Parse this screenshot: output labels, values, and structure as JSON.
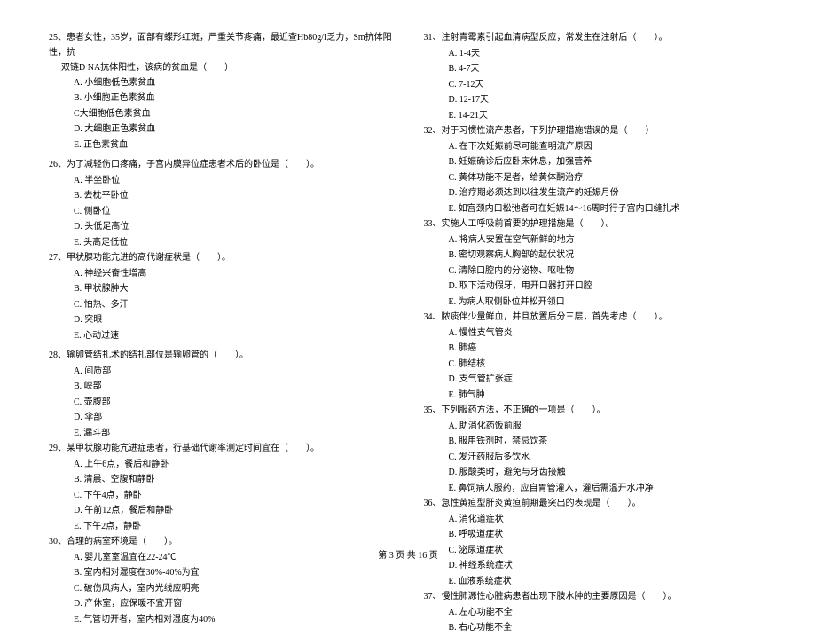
{
  "footer": "第 3 页 共 16 页",
  "left": {
    "q25": {
      "line1": "25、患者女性，35岁，面部有蝶形红斑，严重关节疼痛，最近查Hb80g/I乏力，Sm抗体阳性，抗",
      "line2": "双链D NA抗体阳性，该病的贫血是（　　）",
      "optA": "A. 小细胞低色素贫血",
      "optB": "B. 小细胞正色素贫血",
      "optC": "C大细胞低色素贫血",
      "optD": "D. 大细胞正色素贫血",
      "optE": "E. 正色素贫血"
    },
    "q26": {
      "stem": "26、为了减轻伤口疼痛，子宫内膜异位症患者术后的卧位是（　　）。",
      "optA": "A. 半坐卧位",
      "optB": "B. 去枕平卧位",
      "optC": "C. 侧卧位",
      "optD": "D. 头低足高位",
      "optE": "E. 头高足低位"
    },
    "q27": {
      "stem": "27、甲状腺功能亢进的高代谢症状是（　　）。",
      "optA": "A. 神经兴奋性增高",
      "optB": "B. 甲状腺肿大",
      "optC": "C. 怕热、多汗",
      "optD": "D. 突眼",
      "optE": "E. 心动过速"
    },
    "q28": {
      "stem": "28、输卵管结扎术的结扎部位是输卵管的（　　）。",
      "optA": "A. 间质部",
      "optB": "B. 峡部",
      "optC": "C. 壶腹部",
      "optD": "D. 伞部",
      "optE": "E. 漏斗部"
    },
    "q29": {
      "stem": "29、某甲状腺功能亢进症患者，行基础代谢率测定时间宜在（　　）。",
      "optA": "A. 上午6点，餐后和静卧",
      "optB": "B. 清晨、空腹和静卧",
      "optC": "C. 下午4点，静卧",
      "optD": "D. 午前12点，餐后和静卧",
      "optE": "E. 下午2点，静卧"
    },
    "q30": {
      "stem": "30、合理的病室环境是（　　）。",
      "optA": "A. 婴儿室室温宜在22-24℃",
      "optB": "B. 室内相对湿度在30%-40%为宜",
      "optC": "C. 破伤风病人，室内光线应明亮",
      "optD": "D. 产休室，应保暖不宜开窗",
      "optE": "E. 气管切开者，室内相对湿度为40%"
    }
  },
  "right": {
    "q31": {
      "stem": "31、注射青霉素引起血清病型反应，常发生在注射后（　　）。",
      "optA": "A. 1-4天",
      "optB": "B. 4-7天",
      "optC": "C. 7-12天",
      "optD": "D. 12-17天",
      "optE": "E. 14-21天"
    },
    "q32": {
      "stem": "32、对于习惯性流产患者，下列护理措施错误的是（　　）",
      "optA": "A. 在下次妊娠前尽可能查明流产原因",
      "optB": "B. 妊娠确诊后应卧床休息，加强营养",
      "optC": "C. 黄体功能不足者，给黄体酮治疗",
      "optD": "D. 治疗期必须达到以往发生流产的妊娠月份",
      "optE": "E. 如宫颈内口松弛者可在妊娠14～16周时行子宫内口缝扎术"
    },
    "q33": {
      "stem": "33、实施人工呼吸前首要的护理措施是（　　）。",
      "optA": "A. 将病人安置在空气新鲜的地方",
      "optB": "B. 密切观察病人胸部的起伏状况",
      "optC": "C. 清除口腔内的分泌物、呕吐物",
      "optD": "D. 取下活动假牙，用开口器打开口腔",
      "optE": "E. 为病人取侧卧位并松开领口"
    },
    "q34": {
      "stem": "34、脓痰伴少量鲜血，并且放置后分三层，首先考虑（　　）。",
      "optA": "A. 慢性支气管炎",
      "optB": "B. 肺癌",
      "optC": "C. 肺结核",
      "optD": "D. 支气管扩张症",
      "optE": "E. 肺气肿"
    },
    "q35": {
      "stem": "35、下列服药方法，不正确的一项是（　　）。",
      "optA": "A. 助消化药饭前服",
      "optB": "B. 服用铁剂时，禁忌饮茶",
      "optC": "C. 发汗药服后多饮水",
      "optD": "D. 服酸类时，避免与牙齿接触",
      "optE": "E. 鼻饲病人服药，应自胃管灌入，灌后需温开水冲净"
    },
    "q36": {
      "stem": "36、急性黄疸型肝炎黄疸前期最突出的表现是（　　）。",
      "optA": "A. 消化道症状",
      "optB": "B. 呼吸道症状",
      "optC": "C. 泌尿道症状",
      "optD": "D. 神经系统症状",
      "optE": "E. 血液系统症状"
    },
    "q37": {
      "stem": "37、慢性肺源性心脏病患者出现下肢水肿的主要原因是（　　）。",
      "optA": "A. 左心功能不全",
      "optB": "B. 右心功能不全"
    }
  }
}
